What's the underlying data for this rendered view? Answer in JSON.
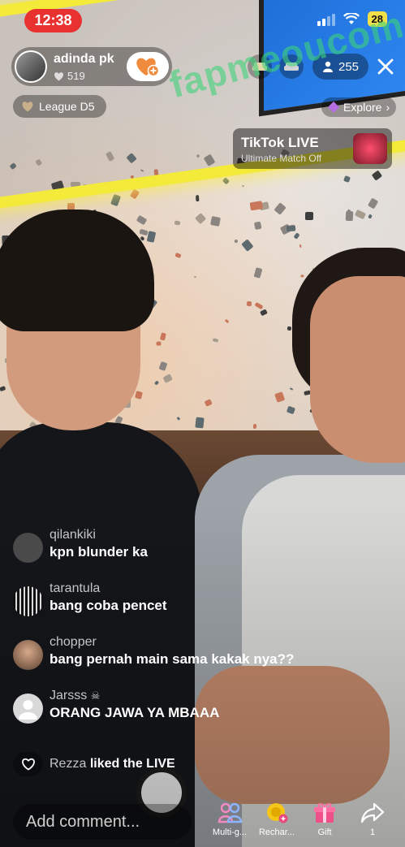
{
  "status_bar": {
    "time": "12:38",
    "battery": "28"
  },
  "host": {
    "name": "adinda pk",
    "likes": "519",
    "league": "League D5"
  },
  "viewers": "255",
  "explore_label": "Explore",
  "watermark": "fapmeoucom",
  "match": {
    "title": "TikTok LIVE",
    "subtitle": "Ultimate Match Off"
  },
  "comments": [
    {
      "user": "qilankiki",
      "text": "kpn blunder ka",
      "avatar_color": "#4a4a4a"
    },
    {
      "user": "tarantula",
      "text": "bang coba pencet",
      "avatar_color": "#222222"
    },
    {
      "user": "chopper",
      "text": "bang pernah main sama kakak nya??",
      "avatar_color": "#b88a6a"
    },
    {
      "user": "Jarsss",
      "text": "ORANG JAWA YA MBAAA",
      "avatar_color": "#d9d9d9"
    }
  ],
  "liked": {
    "user": "Rezza",
    "text": "liked the LIVE"
  },
  "comment_placeholder": "Add comment...",
  "bottom_actions": [
    {
      "label": "Multi-g...",
      "icon": "multi-guest-icon"
    },
    {
      "label": "Rechar...",
      "icon": "recharge-icon"
    },
    {
      "label": "Gift",
      "icon": "gift-icon"
    },
    {
      "label": "1",
      "icon": "share-icon"
    }
  ],
  "colors": {
    "accent_red": "#e8322f",
    "battery": "#f2e04a",
    "follow_heart": "#f08a3c"
  }
}
